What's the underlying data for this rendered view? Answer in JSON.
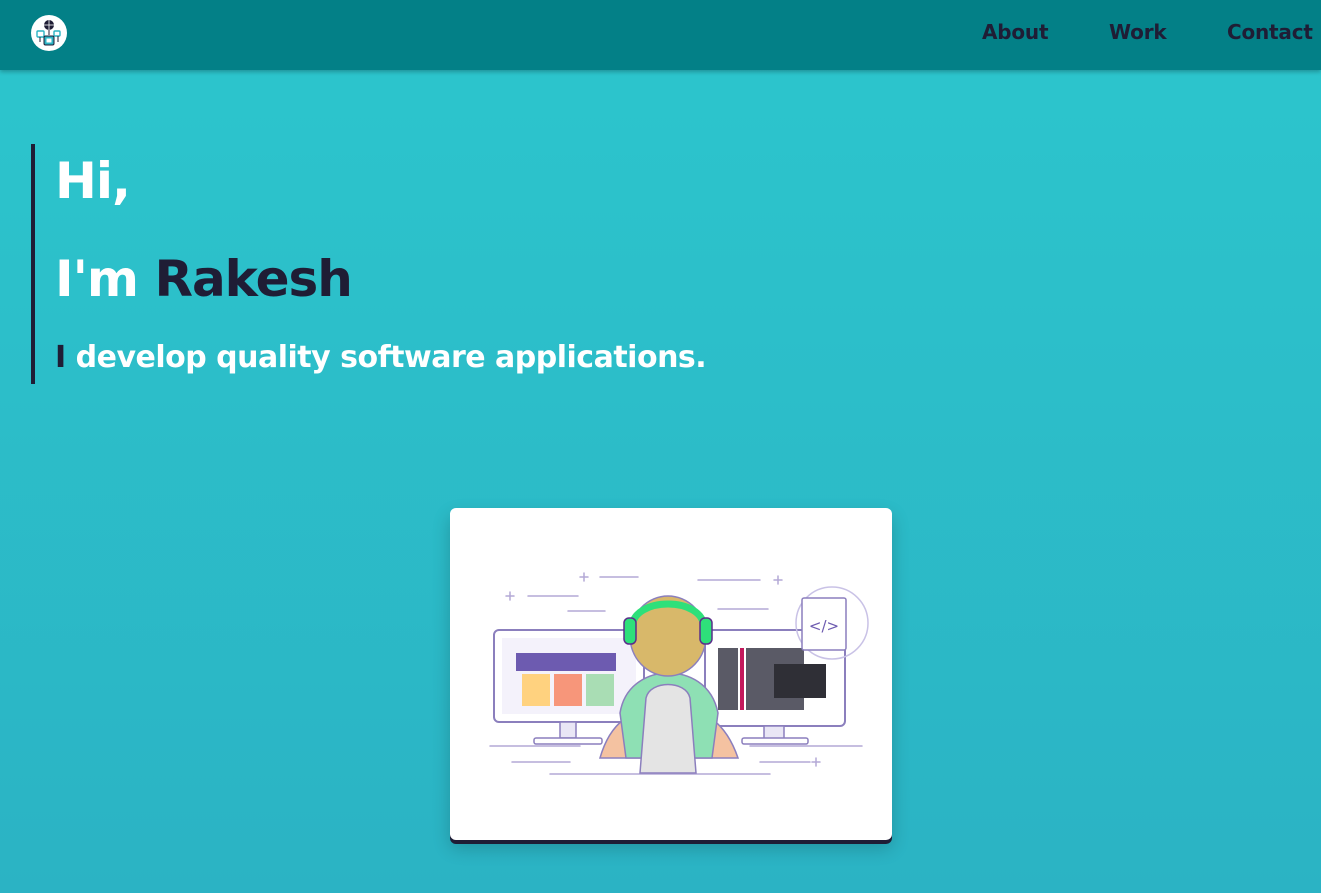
{
  "nav": {
    "logo_icon": "developer-globe-logo-icon",
    "links": [
      {
        "label": "About"
      },
      {
        "label": "Work"
      },
      {
        "label": "Contact"
      }
    ]
  },
  "hero": {
    "greeting": "Hi,",
    "intro_prefix": "I'm",
    "name": "Rakesh",
    "cursor": "I",
    "tagline": "develop quality software applications."
  },
  "illustration": {
    "icon": "developer-at-desk-illustration",
    "code_tag": "</>"
  },
  "colors": {
    "navbar": "#038087",
    "background": "#2cc6cd",
    "dark": "#1f1d35",
    "white": "#ffffff"
  }
}
